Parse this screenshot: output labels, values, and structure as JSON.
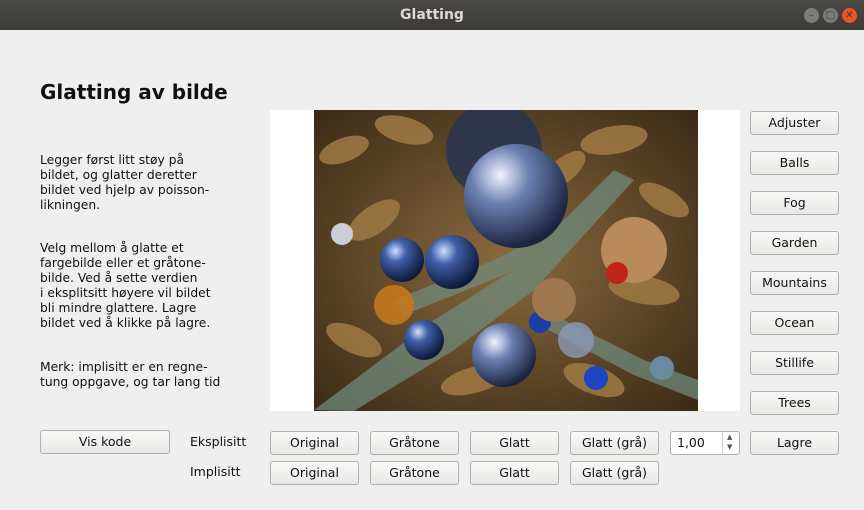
{
  "window": {
    "title": "Glatting"
  },
  "heading": "Glatting av bilde",
  "paragraphs": [
    "Legger først litt støy på\nbildet, og glatter deretter\nbildet ved hjelp av poisson-\nlikningen.",
    "Velg mellom å glatte et\nfargebilde eller et gråtone-\nbilde. Ved å sette verdien\ni eksplitsitt høyere vil bildet\nbli mindre glattere. Lagre\nbildet ved å klikke på lagre.",
    "Merk: implisitt er en regne-\ntung oppgave, og tar lang tid"
  ],
  "image_buttons": [
    "Adjuster",
    "Balls",
    "Fog",
    "Garden",
    "Mountains",
    "Ocean",
    "Stillife",
    "Trees"
  ],
  "vis_kode": "Vis kode",
  "rows": {
    "explicit_label": "Eksplisitt",
    "implicit_label": "Implisitt",
    "buttons": [
      "Original",
      "Gråtone",
      "Glatt",
      "Glatt (grå)"
    ]
  },
  "spin_value": "1,00",
  "lagre": "Lagre",
  "colors": {
    "titlebar": "#3c3b37",
    "close": "#e95420",
    "background": "#efefef"
  }
}
